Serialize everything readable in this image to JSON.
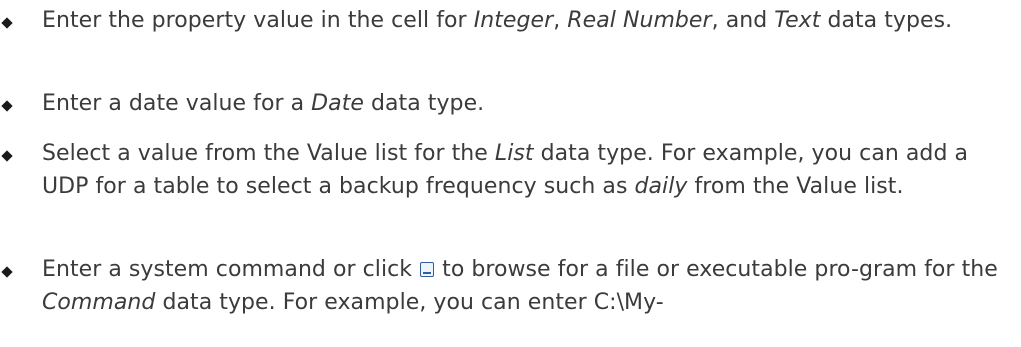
{
  "bullets": [
    {
      "t1": "Enter the property value in the cell for ",
      "e1": "Integer",
      "t2": ", ",
      "e2": "Real Number",
      "t3": ", and ",
      "e3": "Text",
      "t4": " data types."
    },
    {
      "t1": "Enter a date value for a ",
      "e1": "Date",
      "t2": " data type."
    },
    {
      "t1": "Select a value from the Value list for the ",
      "e1": "List",
      "t2": " data type. For example, you can add a UDP for a table to select a backup frequency such as ",
      "e2": "daily",
      "t3": " from the Value list."
    },
    {
      "t1": "Enter a system command or click ",
      "icon": "browse-icon",
      "t2": " to browse for a file or executable pro-gram for the ",
      "e1": "Command",
      "t3": " data type. For example, you can enter C:\\My-"
    }
  ]
}
